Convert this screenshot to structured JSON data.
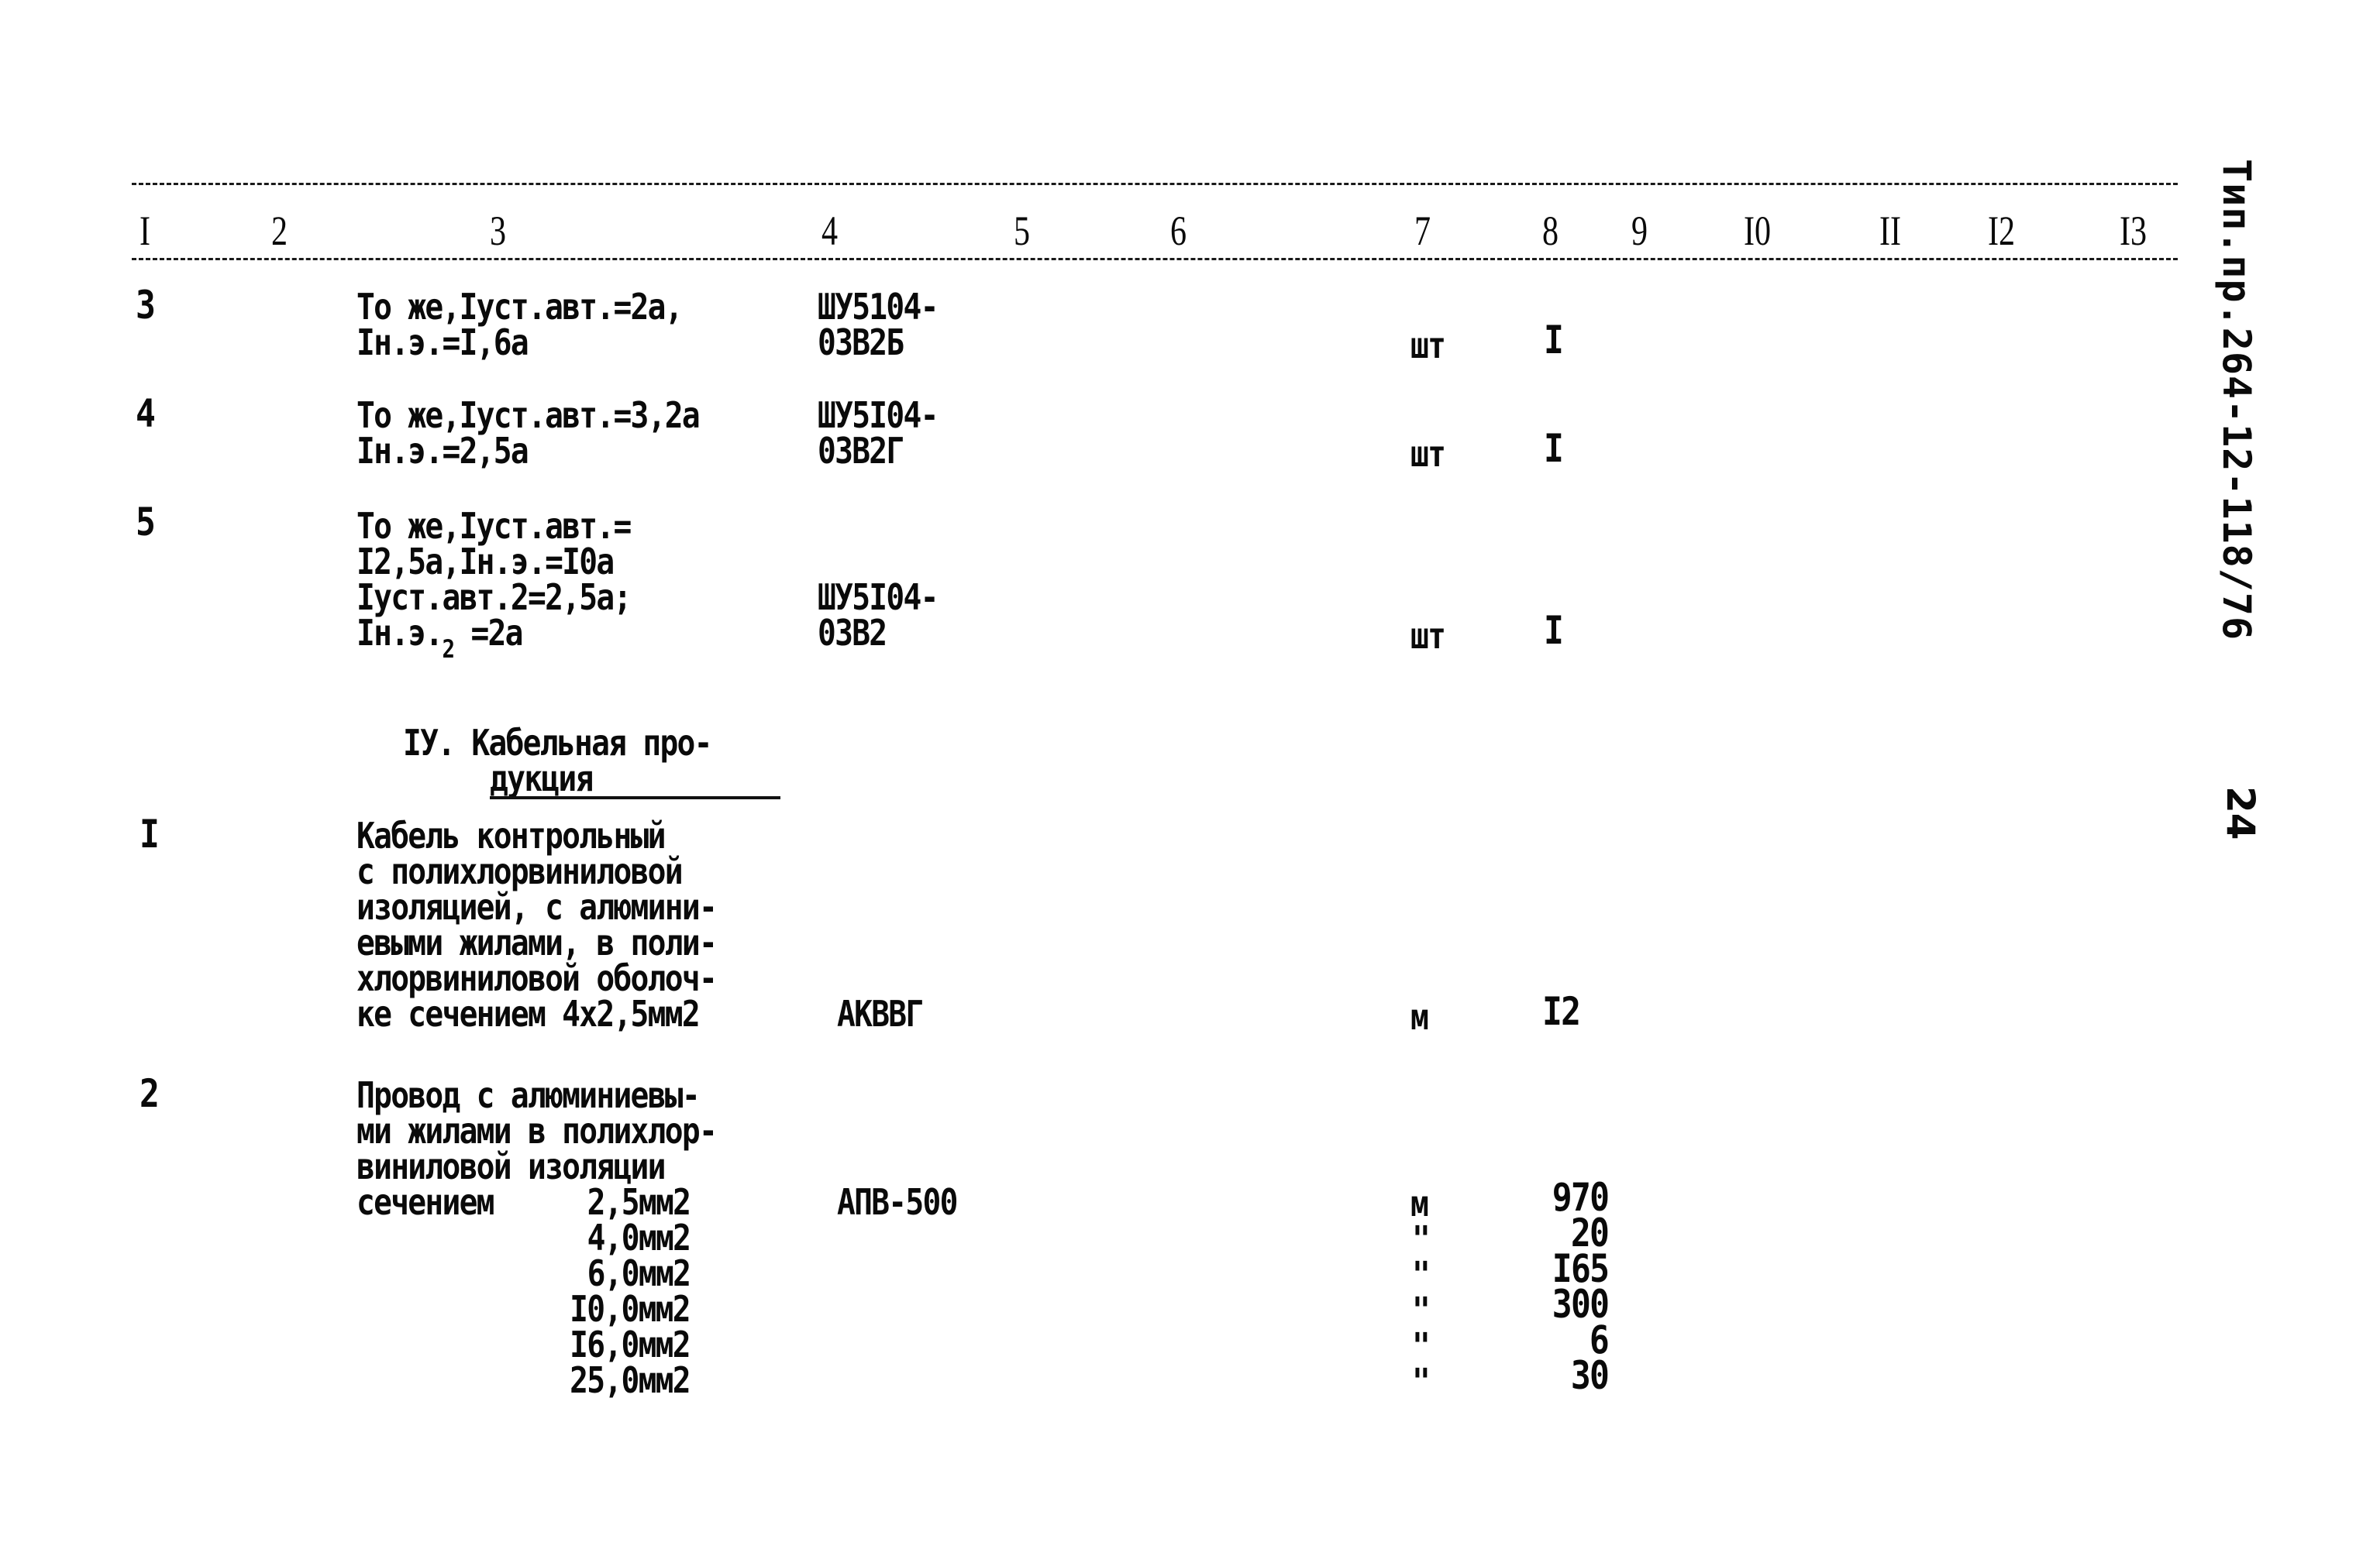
{
  "document": {
    "side_label": "Тип.пр.264-12-118/76",
    "page_number": "24"
  },
  "columns": [
    "I",
    "2",
    "3",
    "4",
    "5",
    "6",
    "7",
    "8",
    "9",
    "I0",
    "II",
    "I2",
    "I3"
  ],
  "rows": [
    {
      "no": "3",
      "description_lines": [
        "То же,Iуст.авт.=2а,",
        "Iн.э.=I,6а"
      ],
      "type_lines": [
        "ШУ5104-",
        "03В2Б"
      ],
      "unit": "шт",
      "qty": "I"
    },
    {
      "no": "4",
      "description_lines": [
        "То же,Iуст.авт.=3,2а",
        "Iн.э.=2,5а"
      ],
      "type_lines": [
        "ШУ5I04-",
        "03В2Г"
      ],
      "unit": "шт",
      "qty": "I"
    },
    {
      "no": "5",
      "description_lines": [
        "То же,Iуст.авт.=",
        "I2,5а,Iн.э.=I0а",
        "Iуст.авт.2=2,5а;",
        "Iн.э."
      ],
      "description_subscript": "2",
      "description_tail": " =2а",
      "type_lines": [
        "ШУ5I04-",
        "03В2"
      ],
      "unit": "шт",
      "qty": "I"
    }
  ],
  "section": {
    "title_line1": "IУ. Кабельная про-",
    "title_line2": "дукция"
  },
  "cable_items": [
    {
      "no": "I",
      "description_lines": [
        "Кабель контрольный",
        "с полихлорвиниловой",
        "изоляцией, с алюмини-",
        "евыми жилами, в поли-",
        "хлорвиниловой оболоч-",
        "ке сечением 4х2,5мм2"
      ],
      "type": "АКВВГ",
      "unit": "м",
      "qty": "I2"
    },
    {
      "no": "2",
      "description_lines": [
        "Провод с алюминиевы-",
        "ми жилами в полихлор-",
        "виниловой изоляции",
        "сечением"
      ],
      "type": "АПВ-500",
      "sizes": [
        {
          "section": "2,5мм2",
          "unit": "м",
          "qty": "970"
        },
        {
          "section": "4,0мм2",
          "unit": "\"",
          "qty": "20"
        },
        {
          "section": "6,0мм2",
          "unit": "\"",
          "qty": "I65"
        },
        {
          "section": "I0,0мм2",
          "unit": "\"",
          "qty": "300"
        },
        {
          "section": "I6,0мм2",
          "unit": "\"",
          "qty": "6"
        },
        {
          "section": "25,0мм2",
          "unit": "\"",
          "qty": "30"
        }
      ]
    }
  ]
}
